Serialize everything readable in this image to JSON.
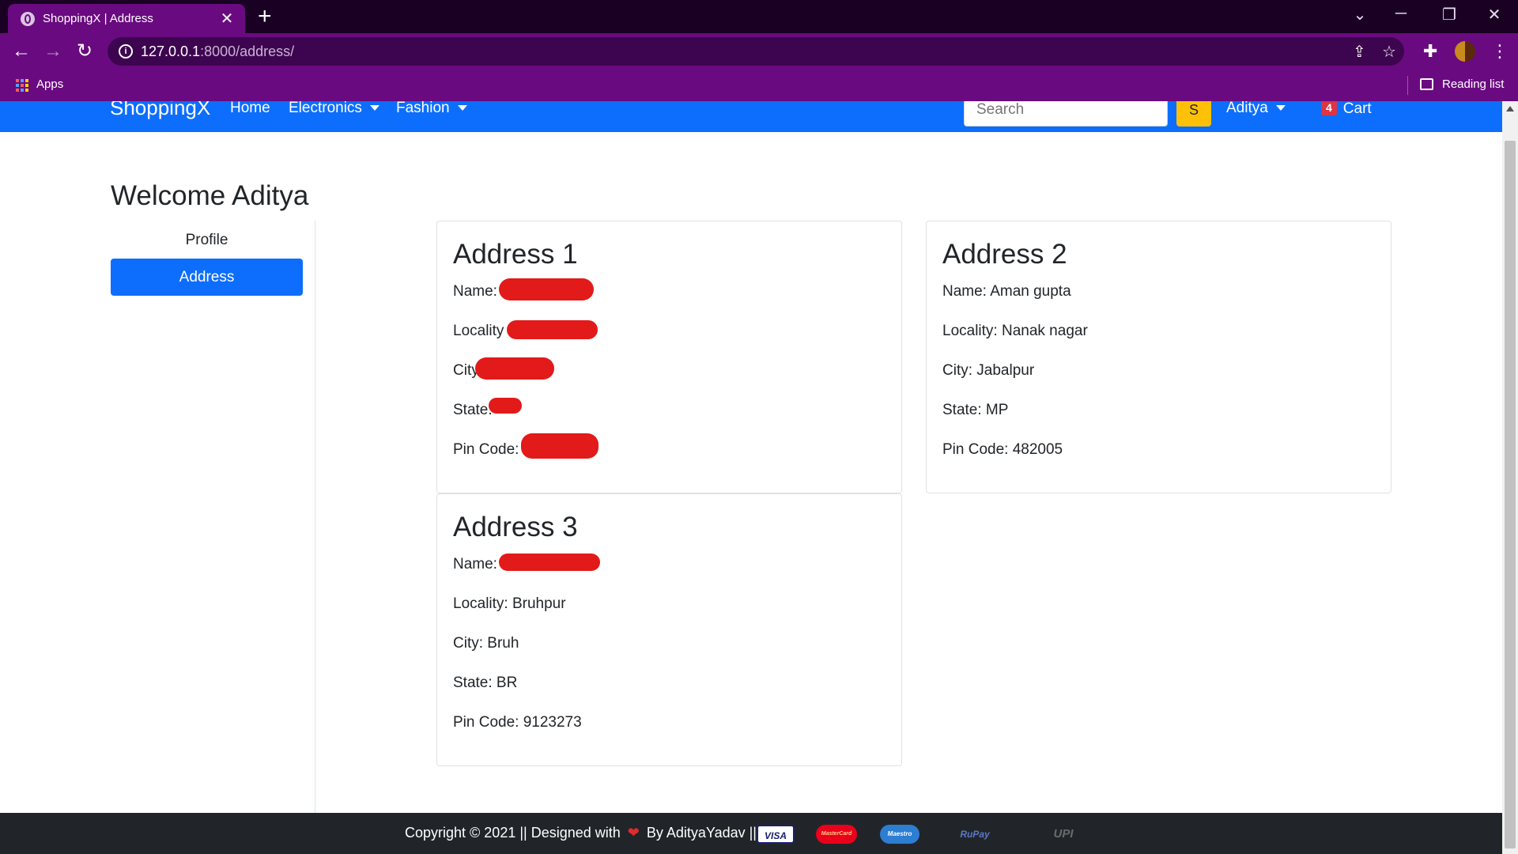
{
  "browser": {
    "tab_title": "ShoppingX | Address",
    "tab_close": "✕",
    "new_tab": "+",
    "url_host": "127.0.0.1",
    "url_rest": ":8000/address/",
    "bookmarks": {
      "apps": "Apps",
      "reading_list": "Reading list"
    }
  },
  "navbar": {
    "brand": "ShoppingX",
    "links": [
      "Home",
      "Electronics",
      "Fashion"
    ],
    "search_placeholder": "Search",
    "search_button": "S",
    "user": "Aditya",
    "cart_count": "4",
    "cart_label": "Cart",
    "color": "#0d6efd"
  },
  "page": {
    "welcome": "Welcome Aditya",
    "sidebar": [
      "Profile",
      "Address"
    ]
  },
  "addresses": [
    {
      "title": "Address 1",
      "name_label": "Name:",
      "locality_label": "Locality",
      "city_label": "City",
      "state_label": "State:",
      "pin_label": "Pin Code:"
    },
    {
      "title": "Address 2",
      "name": "Name: Aman gupta",
      "locality": "Locality: Nanak nagar",
      "city": "City: Jabalpur",
      "state": "State: MP",
      "pin": "Pin Code: 482005"
    },
    {
      "title": "Address 3",
      "name_label": "Name:",
      "locality": "Locality: Bruhpur",
      "city": "City: Bruh",
      "state": "State: BR",
      "pin": "Pin Code: 9123273"
    }
  ],
  "footer": {
    "text_1": "Copyright © 2021 || Designed with",
    "text_2": "By AdityaYadav ||",
    "payments": [
      "VISA",
      "MasterCard",
      "Maestro",
      "RuPay",
      "UPI"
    ]
  }
}
